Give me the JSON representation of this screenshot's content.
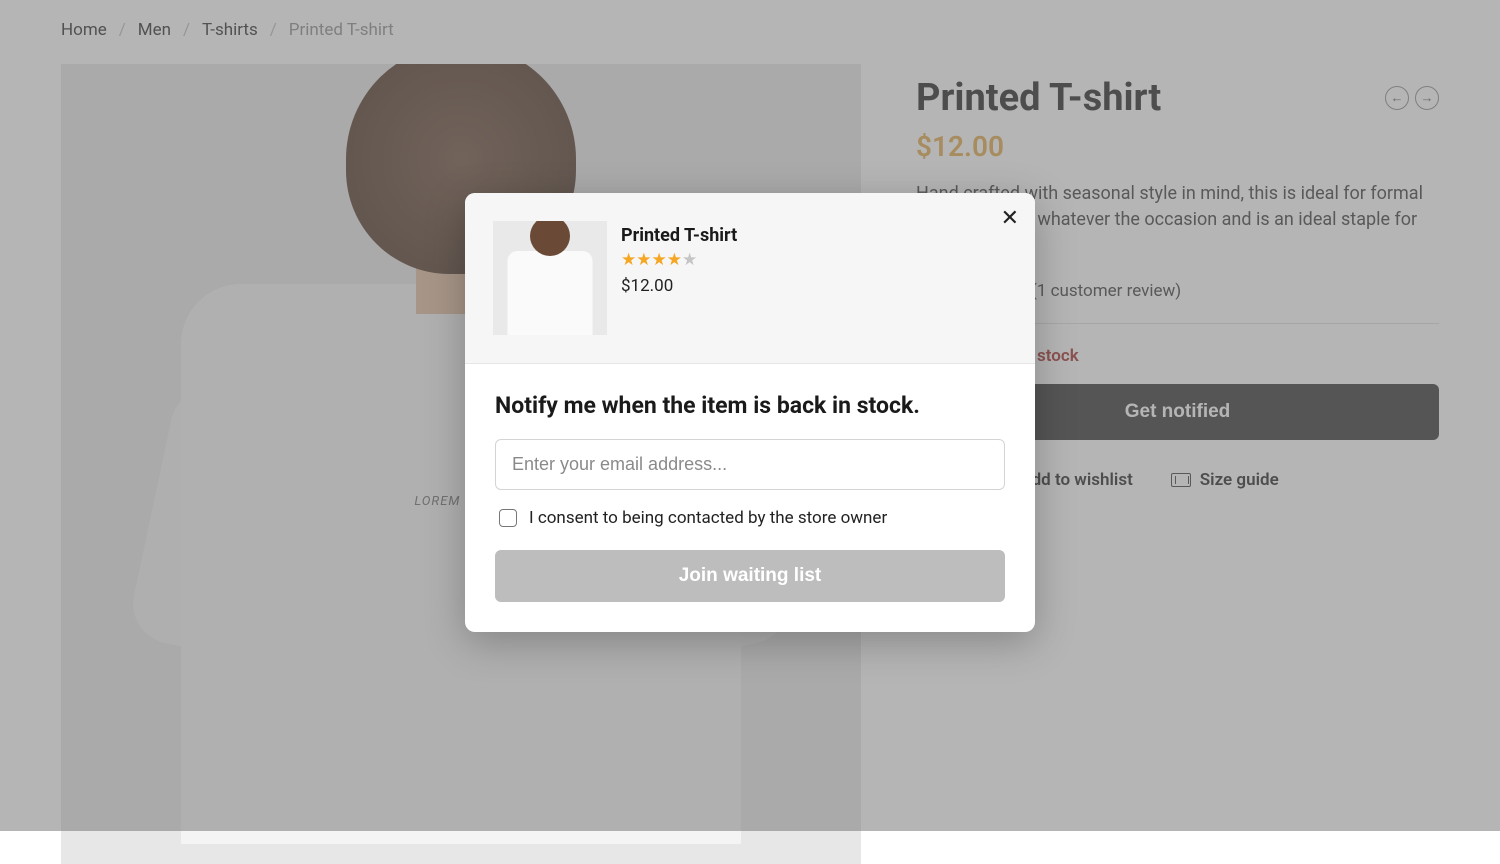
{
  "breadcrumb": {
    "items": [
      "Home",
      "Men",
      "T-shirts"
    ],
    "current": "Printed T-shirt"
  },
  "product": {
    "title": "Printed T-shirt",
    "price": "$12.00",
    "description": "Hand crafted with seasonal style in mind, this is ideal for formal or casual wear whatever the occasion and is an ideal staple for any wardrobe.",
    "reviews_label": "(1 customer review)",
    "stock_status": "Out of stock",
    "notify_label": "Get notified",
    "wishlist_label": "Add to wishlist",
    "size_guide_label": "Size guide",
    "image_print_text": "LOREM IPSUM"
  },
  "modal": {
    "title": "Printed T-shirt",
    "rating": 4,
    "price": "$12.00",
    "heading": "Notify me when the item is back in stock.",
    "email_placeholder": "Enter your email address...",
    "consent_label": "I consent to being contacted by the store owner",
    "submit_label": "Join waiting list"
  }
}
